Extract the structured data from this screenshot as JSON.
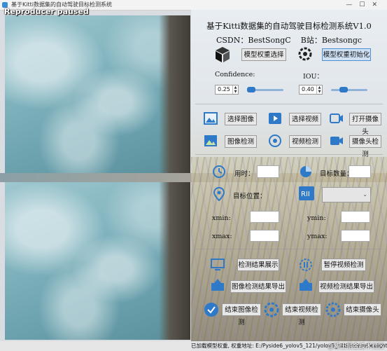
{
  "window": {
    "title": "基于Kitti数据集的自动驾驶目标检测系统",
    "watermark_top": "Reproducer paused"
  },
  "header": {
    "title": "基于Kitti数据集的自动驾驶目标检测系统V1.0",
    "csdn": "CSDN：BestSongC",
    "bilibili": "B站：Bestsongc"
  },
  "model": {
    "select_label": "模型权重选择",
    "init_label": "模型权重初始化"
  },
  "params": {
    "confidence_label": "Confidence:",
    "confidence_value": "0.25",
    "confidence_level": 0.25,
    "iou_label": "IOU：",
    "iou_value": "0.40",
    "iou_level": 0.4
  },
  "source_buttons": {
    "select_image": "选择图像",
    "select_video": "选择视频",
    "open_camera": "打开摄像头",
    "image_detect": "图像检测",
    "video_detect": "视频检测",
    "camera_detect": "摄像头检测"
  },
  "results": {
    "time_label": "用时：",
    "count_label": "目标数量：",
    "type_label": "目标位置：",
    "xmin": "xmin:",
    "ymin": "ymin:",
    "xmax": "xmax:",
    "ymax": "ymax:"
  },
  "actions": {
    "show_results": "检测结果展示",
    "pause_video": "暂停视频检测",
    "export_image": "图像检测结果导出",
    "export_video": "视频检测结果导出",
    "end_image": "结束图像检测",
    "end_video": "结束视频检测",
    "end_camera": "结束摄像头"
  },
  "status": {
    "text": "已加载模型权重, 权重地址: E:/Pyside6_yolov5_121/yolov5_kitti/trained/weights/best.pt",
    "watermark": "@稀土掘金技术社区"
  },
  "colors": {
    "accent_blue": "#2f79c9",
    "button_bg": "#e8e8e8",
    "sea": "#7fb2bd"
  }
}
